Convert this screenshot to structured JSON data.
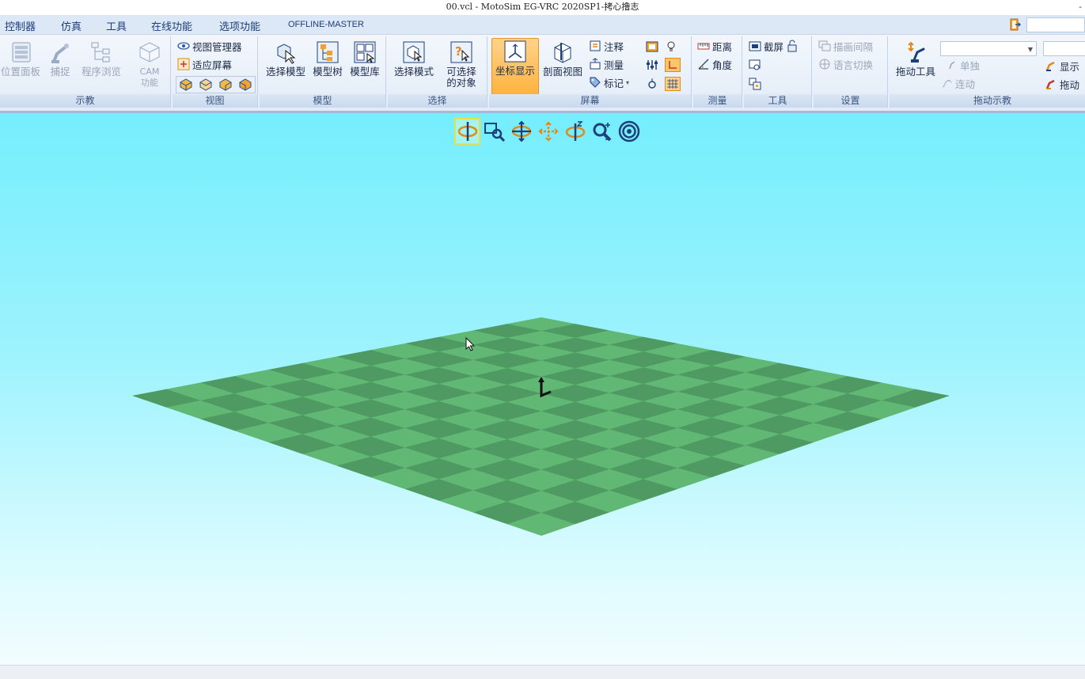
{
  "window": {
    "title": "00.vcl - MotoSim EG-VRC 2020SP1-拷心撸志",
    "minimize_glyph": "-"
  },
  "menu": [
    "控制器",
    "仿真",
    "工具",
    "在线功能",
    "选项功能",
    "OFFLINE-MASTER"
  ],
  "ribbon": {
    "teach": {
      "label": "示教",
      "position_panel": "位置面板",
      "capture": "捕捉",
      "program_browse": "程序浏览",
      "cam_line1": "CAM",
      "cam_line2": "功能"
    },
    "view": {
      "label": "视图",
      "view_manager": "视图管理器",
      "fit_screen": "适应屏幕"
    },
    "model": {
      "label": "模型",
      "select_model": "选择模型",
      "model_tree": "模型树",
      "model_library": "模型库"
    },
    "select": {
      "label": "选择",
      "select_mode": "选择模式",
      "selectable_line1": "可选择",
      "selectable_line2": "的对象"
    },
    "screen": {
      "label": "屏幕",
      "coord_display": "坐标显示",
      "section_view": "剖面视图",
      "annotation": "注释",
      "measure": "测量",
      "marker": "标记"
    },
    "measure": {
      "label": "测量",
      "distance": "距离",
      "angle": "角度"
    },
    "tools": {
      "label": "工具",
      "screenshot": "截屏"
    },
    "settings": {
      "label": "设置",
      "draw_interval": "描画间隔",
      "language_switch": "语言切换"
    },
    "drag_teach": {
      "label": "拖动示教",
      "drag_tool": "拖动工具",
      "single": "单独",
      "continuous": "连动",
      "display": "显示",
      "drag": "拖动"
    }
  },
  "view_toolbar": [
    "rotate-icon",
    "zoom-window-icon",
    "pan-rotate-icon",
    "move-icon",
    "rotate-z-icon",
    "zoom-icon",
    "target-icon"
  ],
  "colors": {
    "accent_active": "#ffb23f",
    "viewport_top": "#75eefd",
    "floor": "#5db56f"
  }
}
